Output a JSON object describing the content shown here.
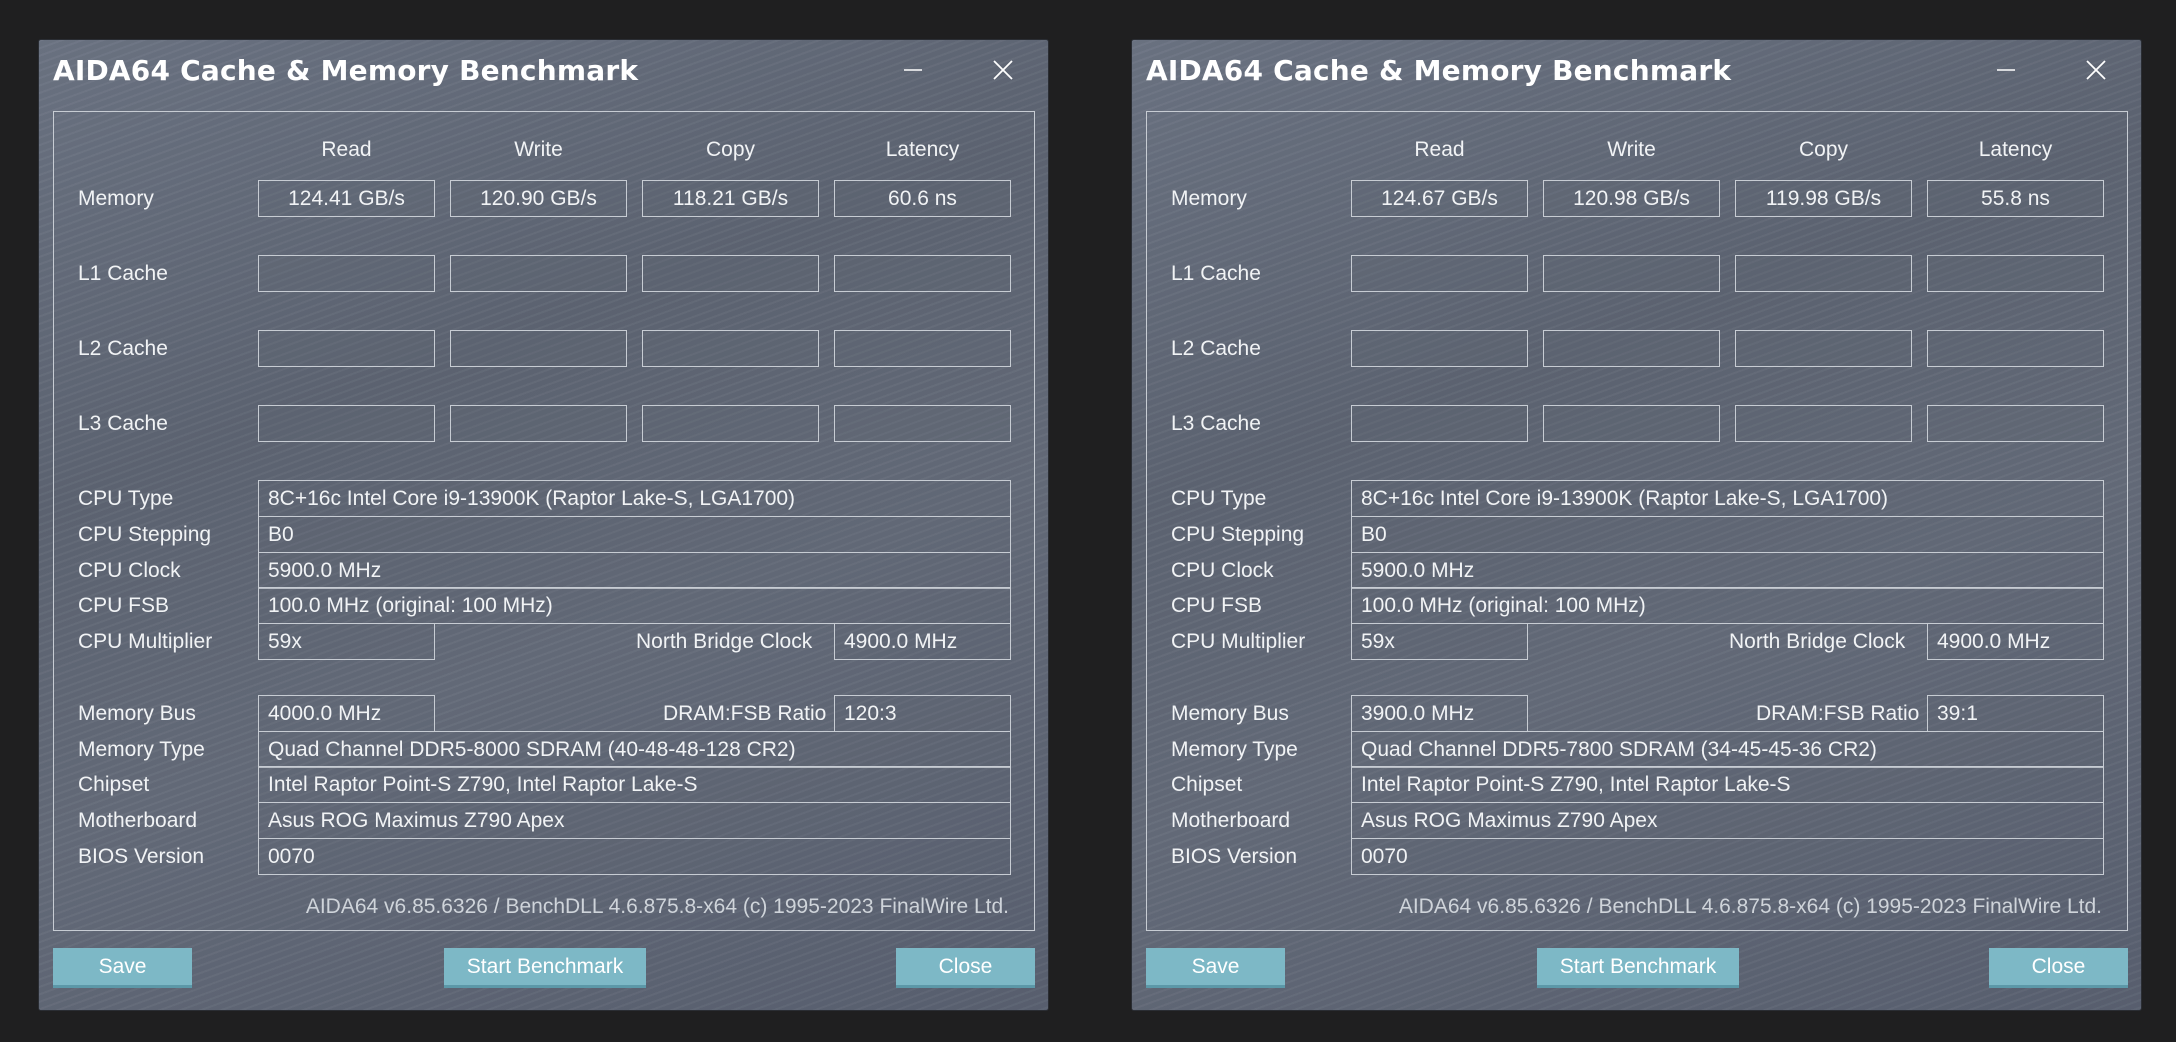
{
  "windows": [
    {
      "title": "AIDA64 Cache & Memory Benchmark",
      "columns": [
        "Read",
        "Write",
        "Copy",
        "Latency"
      ],
      "rows": [
        {
          "label": "Memory",
          "values": [
            "124.41 GB/s",
            "120.90 GB/s",
            "118.21 GB/s",
            "60.6 ns"
          ]
        },
        {
          "label": "L1 Cache",
          "values": [
            "",
            "",
            "",
            ""
          ]
        },
        {
          "label": "L2 Cache",
          "values": [
            "",
            "",
            "",
            ""
          ]
        },
        {
          "label": "L3 Cache",
          "values": [
            "",
            "",
            "",
            ""
          ]
        }
      ],
      "cpu_type_label": "CPU Type",
      "cpu_type": "8C+16c Intel Core i9-13900K  (Raptor Lake-S, LGA1700)",
      "cpu_stepping_label": "CPU Stepping",
      "cpu_stepping": "B0",
      "cpu_clock_label": "CPU Clock",
      "cpu_clock": "5900.0 MHz",
      "cpu_fsb_label": "CPU FSB",
      "cpu_fsb": "100.0 MHz  (original: 100 MHz)",
      "cpu_multiplier_label": "CPU Multiplier",
      "cpu_multiplier": "59x",
      "nb_clock_label": "North Bridge Clock",
      "nb_clock": "4900.0 MHz",
      "memory_bus_label": "Memory Bus",
      "memory_bus": "4000.0 MHz",
      "dram_ratio_label": "DRAM:FSB Ratio",
      "dram_ratio": "120:3",
      "memory_type_label": "Memory Type",
      "memory_type": "Quad Channel DDR5-8000 SDRAM  (40-48-48-128 CR2)",
      "chipset_label": "Chipset",
      "chipset": "Intel Raptor Point-S Z790, Intel Raptor Lake-S",
      "motherboard_label": "Motherboard",
      "motherboard": "Asus ROG Maximus Z790 Apex",
      "bios_label": "BIOS Version",
      "bios": "0070",
      "footer": "AIDA64 v6.85.6326 / BenchDLL 4.6.875.8-x64  (c) 1995-2023 FinalWire Ltd.",
      "buttons": {
        "save": "Save",
        "start": "Start Benchmark",
        "close": "Close"
      }
    },
    {
      "title": "AIDA64 Cache & Memory Benchmark",
      "columns": [
        "Read",
        "Write",
        "Copy",
        "Latency"
      ],
      "rows": [
        {
          "label": "Memory",
          "values": [
            "124.67 GB/s",
            "120.98 GB/s",
            "119.98 GB/s",
            "55.8 ns"
          ]
        },
        {
          "label": "L1 Cache",
          "values": [
            "",
            "",
            "",
            ""
          ]
        },
        {
          "label": "L2 Cache",
          "values": [
            "",
            "",
            "",
            ""
          ]
        },
        {
          "label": "L3 Cache",
          "values": [
            "",
            "",
            "",
            ""
          ]
        }
      ],
      "cpu_type_label": "CPU Type",
      "cpu_type": "8C+16c Intel Core i9-13900K  (Raptor Lake-S, LGA1700)",
      "cpu_stepping_label": "CPU Stepping",
      "cpu_stepping": "B0",
      "cpu_clock_label": "CPU Clock",
      "cpu_clock": "5900.0 MHz",
      "cpu_fsb_label": "CPU FSB",
      "cpu_fsb": "100.0 MHz  (original: 100 MHz)",
      "cpu_multiplier_label": "CPU Multiplier",
      "cpu_multiplier": "59x",
      "nb_clock_label": "North Bridge Clock",
      "nb_clock": "4900.0 MHz",
      "memory_bus_label": "Memory Bus",
      "memory_bus": "3900.0 MHz",
      "dram_ratio_label": "DRAM:FSB Ratio",
      "dram_ratio": "39:1",
      "memory_type_label": "Memory Type",
      "memory_type": "Quad Channel DDR5-7800 SDRAM  (34-45-45-36 CR2)",
      "chipset_label": "Chipset",
      "chipset": "Intel Raptor Point-S Z790, Intel Raptor Lake-S",
      "motherboard_label": "Motherboard",
      "motherboard": "Asus ROG Maximus Z790 Apex",
      "bios_label": "BIOS Version",
      "bios": "0070",
      "footer": "AIDA64 v6.85.6326 / BenchDLL 4.6.875.8-x64  (c) 1995-2023 FinalWire Ltd.",
      "buttons": {
        "save": "Save",
        "start": "Start Benchmark",
        "close": "Close"
      }
    }
  ]
}
